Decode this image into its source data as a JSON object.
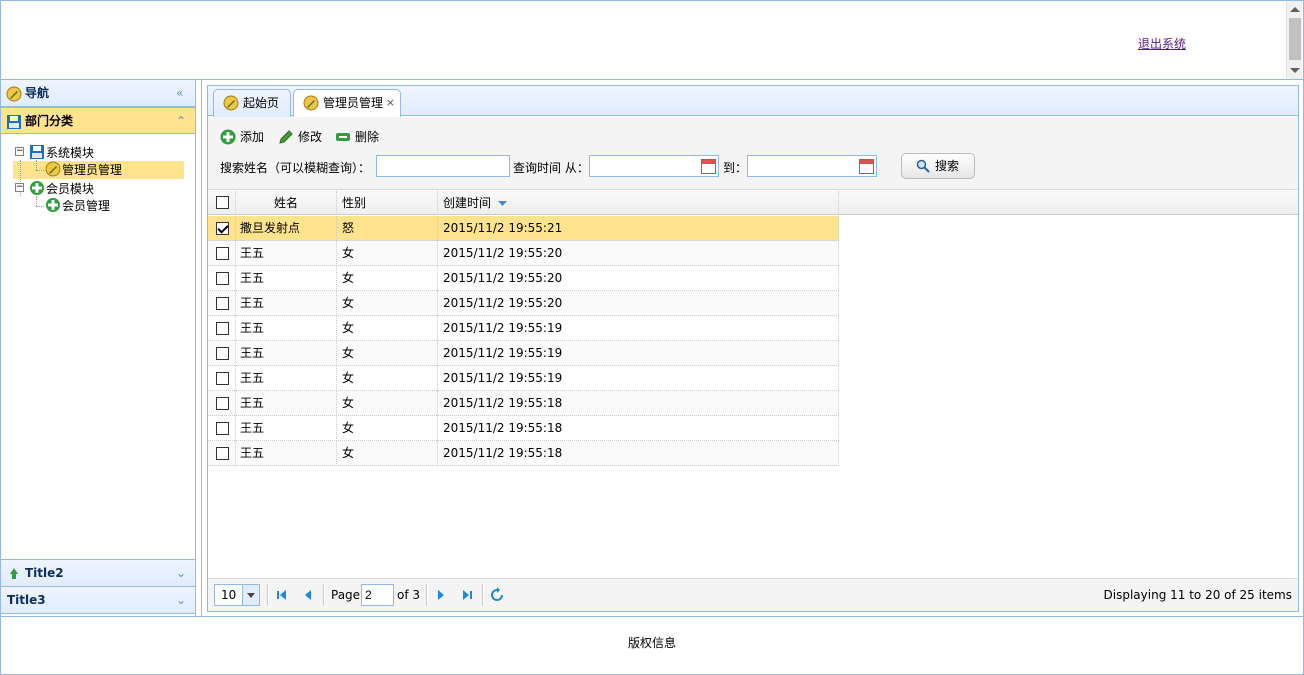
{
  "header": {
    "logout_label": "退出系统"
  },
  "west": {
    "title": "导航",
    "sections": [
      {
        "title": "部门分类",
        "expanded": true
      },
      {
        "title": "Title2",
        "expanded": false
      },
      {
        "title": "Title3",
        "expanded": false
      }
    ],
    "tree": [
      {
        "label": "系统模块",
        "children": [
          {
            "label": "管理员管理",
            "selected": true
          }
        ]
      },
      {
        "label": "会员模块",
        "children": [
          {
            "label": "会员管理"
          }
        ]
      }
    ]
  },
  "tabs": [
    {
      "label": "起始页",
      "active": false,
      "closable": false
    },
    {
      "label": "管理员管理",
      "active": true,
      "closable": true
    }
  ],
  "toolbar": {
    "add_label": "添加",
    "edit_label": "修改",
    "delete_label": "删除",
    "search_name_label": "搜索姓名（可以模糊查询）：",
    "search_name_value": "",
    "time_from_label": "查询时间 从：",
    "time_from_value": "",
    "time_to_label": "到：",
    "time_to_value": "",
    "search_button_label": "搜索"
  },
  "grid": {
    "columns": [
      "姓名",
      "性别",
      "创建时间"
    ],
    "sort_column": "创建时间",
    "sort_order": "desc",
    "rows": [
      {
        "name": "撒旦发射点",
        "gender": "怒",
        "created": "2015/11/2 19:55:21",
        "checked": true
      },
      {
        "name": "王五",
        "gender": "女",
        "created": "2015/11/2 19:55:20",
        "checked": false
      },
      {
        "name": "王五",
        "gender": "女",
        "created": "2015/11/2 19:55:20",
        "checked": false
      },
      {
        "name": "王五",
        "gender": "女",
        "created": "2015/11/2 19:55:20",
        "checked": false
      },
      {
        "name": "王五",
        "gender": "女",
        "created": "2015/11/2 19:55:19",
        "checked": false
      },
      {
        "name": "王五",
        "gender": "女",
        "created": "2015/11/2 19:55:19",
        "checked": false
      },
      {
        "name": "王五",
        "gender": "女",
        "created": "2015/11/2 19:55:19",
        "checked": false
      },
      {
        "name": "王五",
        "gender": "女",
        "created": "2015/11/2 19:55:18",
        "checked": false
      },
      {
        "name": "王五",
        "gender": "女",
        "created": "2015/11/2 19:55:18",
        "checked": false
      },
      {
        "name": "王五",
        "gender": "女",
        "created": "2015/11/2 19:55:18",
        "checked": false
      }
    ]
  },
  "pager": {
    "page_size": "10",
    "page_label": "Page",
    "current_page": "2",
    "of_label": "of 3",
    "summary": "Displaying 11 to 20 of 25 items"
  },
  "footer": {
    "copyright": "版权信息"
  },
  "colors": {
    "border": "#95b8e7",
    "header_bg": "#e0ecff",
    "selected": "#ffe48d",
    "icon_blue": "#1e88e5",
    "icon_green": "#2e9e3e"
  }
}
